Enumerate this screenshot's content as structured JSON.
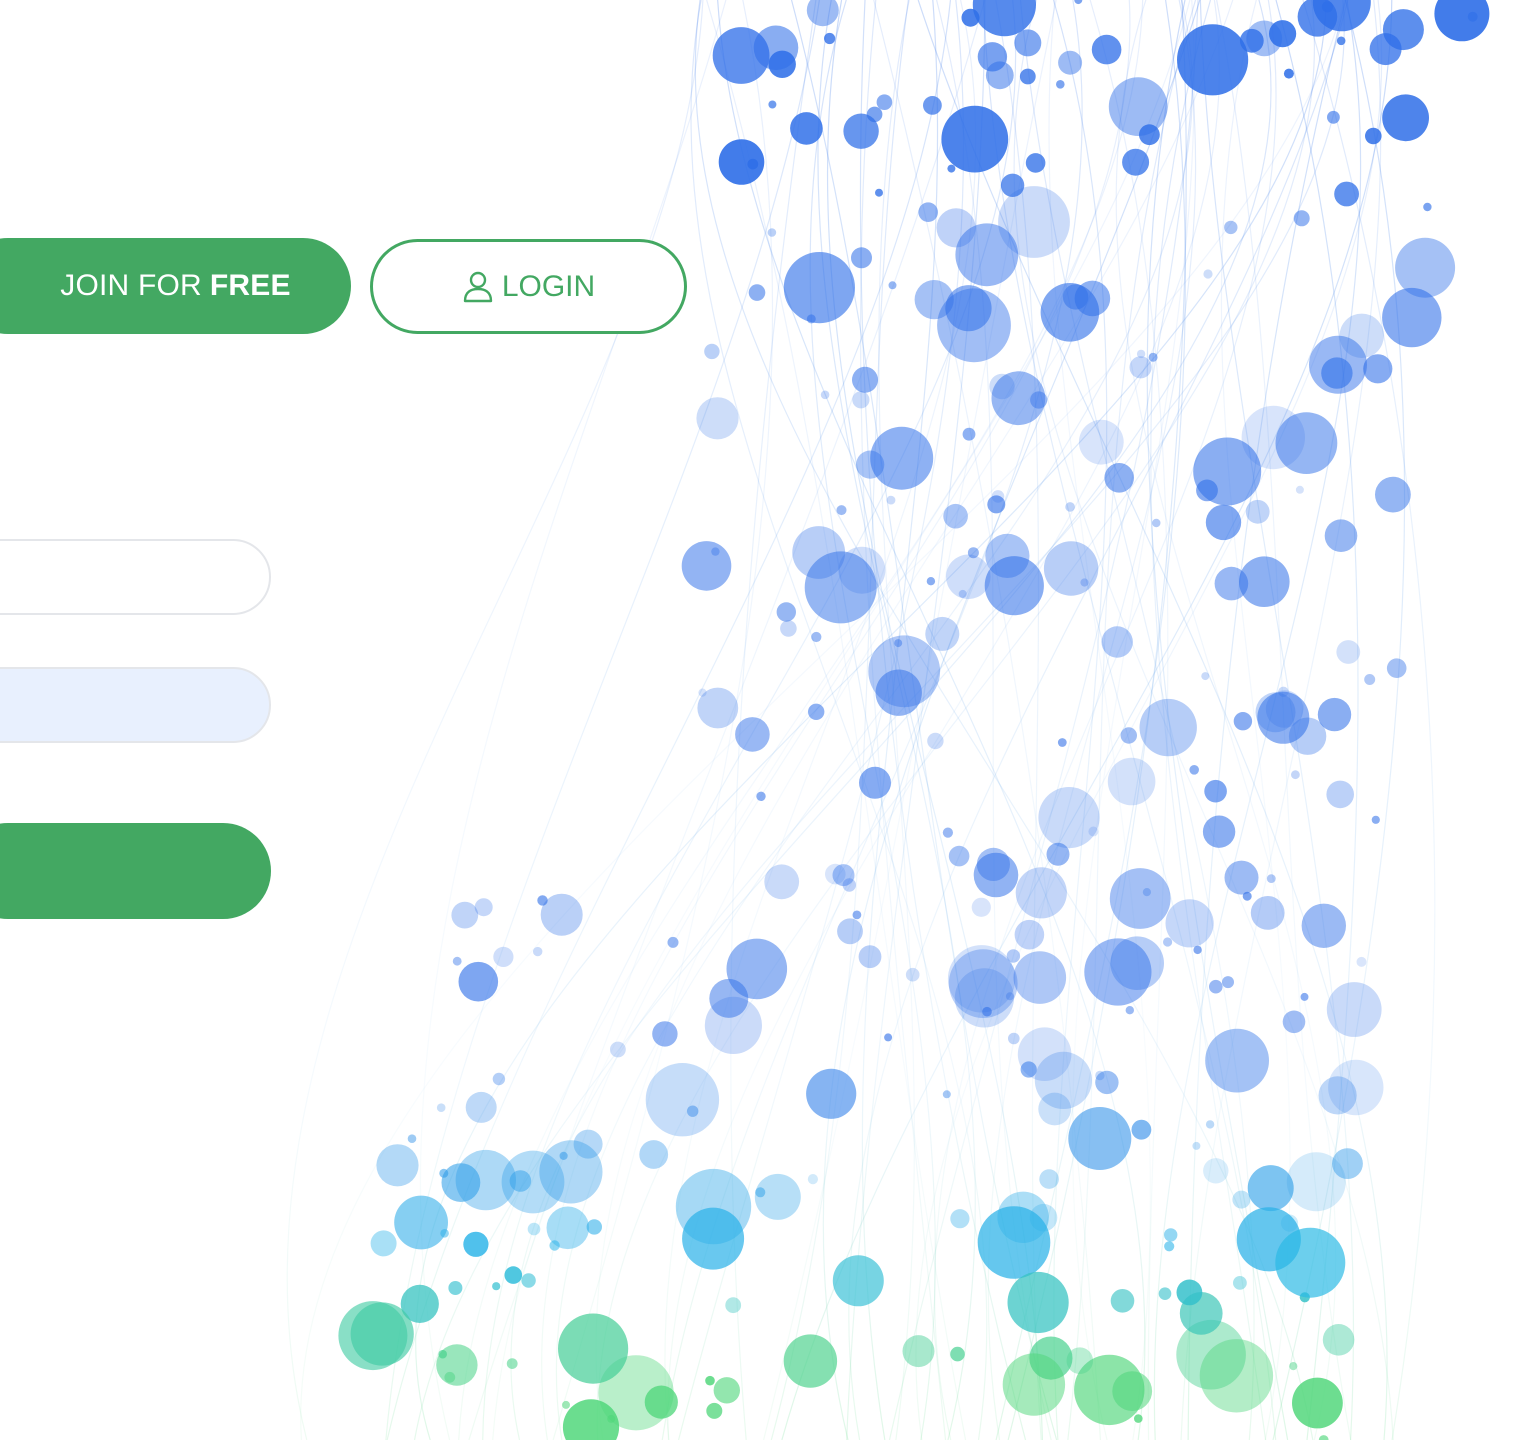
{
  "header": {
    "join_label": "JOIN FOR ",
    "join_emphasis": "FREE",
    "login_label": "LOGIN",
    "login_icon": "user-icon"
  },
  "form": {
    "username_value": "",
    "password_value": "",
    "submit_label": ""
  },
  "footer_link": {
    "text": "!"
  },
  "colors": {
    "primary_green": "#43a862",
    "link_blue": "#2d8ce6",
    "autofill_blue": "#e8f0fe",
    "bubble_blue": "#2f6fe8",
    "bubble_cyan": "#29b8e8",
    "bubble_green": "#4fd67a"
  }
}
